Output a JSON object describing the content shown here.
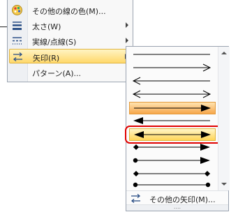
{
  "menu": {
    "items": [
      {
        "label": "その他の線の色(M)...",
        "icon": "color-palette-icon",
        "submenu": false
      },
      {
        "label": "太さ(W)",
        "icon": "line-weight-icon",
        "submenu": true
      },
      {
        "label": "実線/点線(S)",
        "icon": "dash-style-icon",
        "submenu": true
      },
      {
        "label": "矢印(R)",
        "icon": "arrow-style-icon",
        "submenu": true,
        "active": true
      },
      {
        "label": "パターン(A)...",
        "icon": "",
        "submenu": false
      }
    ]
  },
  "arrows_submenu": {
    "options": [
      {
        "name": "plain-line",
        "start": "none",
        "end": "none"
      },
      {
        "name": "open-arrow-right",
        "start": "none",
        "end": "open"
      },
      {
        "name": "open-arrow-left",
        "start": "open",
        "end": "none"
      },
      {
        "name": "open-arrow-both",
        "start": "open",
        "end": "open"
      },
      {
        "name": "filled-arrow-right",
        "start": "none",
        "end": "filled",
        "state": "hover"
      },
      {
        "name": "filled-arrow-left",
        "start": "filled",
        "end": "none"
      },
      {
        "name": "filled-arrow-both",
        "start": "filled",
        "end": "filled",
        "state": "selected"
      },
      {
        "name": "diamond-to-arrow",
        "start": "diamond",
        "end": "filled"
      },
      {
        "name": "dot-to-arrow",
        "start": "dot",
        "end": "filled"
      },
      {
        "name": "diamond-both",
        "start": "diamond",
        "end": "diamond"
      },
      {
        "name": "dot-both",
        "start": "dot",
        "end": "dot"
      }
    ],
    "more_label": "その他の矢印(M)...",
    "grip": "....",
    "highlight_color": "#e00000"
  }
}
